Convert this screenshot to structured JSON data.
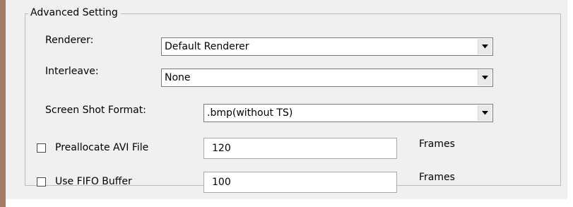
{
  "group": {
    "title": "Advanced Setting"
  },
  "renderer": {
    "label": "Renderer:",
    "value": "Default Renderer",
    "arrow_icon": "chevron-down-icon"
  },
  "interleave": {
    "label": "Interleave:",
    "value": "None",
    "arrow_icon": "chevron-down-icon"
  },
  "screenshot_format": {
    "label": "Screen Shot Format:",
    "value": ".bmp(without TS)",
    "arrow_icon": "chevron-down-icon"
  },
  "preallocate_avi": {
    "label": "Preallocate AVI File",
    "checked": false,
    "value": "120",
    "unit": "Frames"
  },
  "fifo_buffer": {
    "label": "Use FIFO Buffer",
    "checked": false,
    "value": "100",
    "unit": "Frames"
  },
  "colors": {
    "panel_background": "#f0f0f0",
    "window_frame": "#a37c68",
    "group_border": "#bcbcbc"
  }
}
